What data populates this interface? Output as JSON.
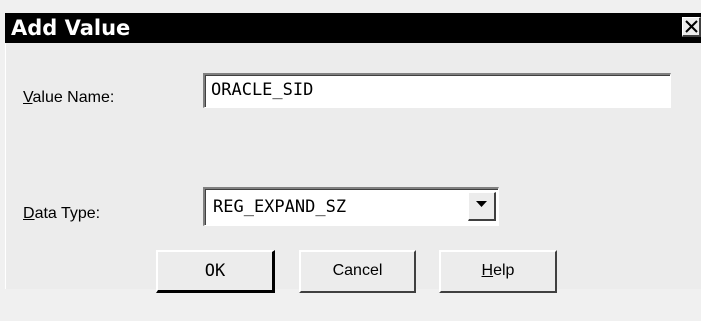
{
  "window": {
    "title": "Add Value"
  },
  "form": {
    "value_name_label_accel": "V",
    "value_name_label_rest": "alue Name:",
    "value_name_value": "ORACLE_SID",
    "data_type_label_accel": "D",
    "data_type_label_rest": "ata Type:",
    "data_type_selected": "REG_EXPAND_SZ"
  },
  "buttons": {
    "ok_label": "OK",
    "cancel_label": "Cancel",
    "help_label_accel": "H",
    "help_label_rest": "elp"
  },
  "icons": {
    "close": "close-icon",
    "dropdown": "chevron-down-icon"
  },
  "colors": {
    "titlebar": "#000000",
    "dialog_background": "#ececec",
    "input_background": "#ffffff"
  }
}
